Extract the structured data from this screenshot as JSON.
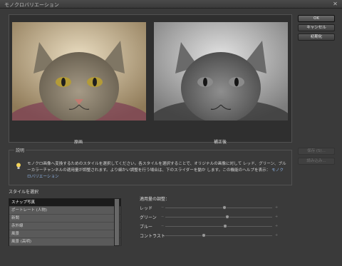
{
  "window": {
    "title": "モノクロバリエーション"
  },
  "buttons": {
    "ok": "OK",
    "cancel": "キャンセル",
    "reset": "初期化",
    "save": "保存 (S)...",
    "load": "読み込み..."
  },
  "preview": {
    "before_label": "原画",
    "after_label": "補正後"
  },
  "description": {
    "legend": "説明",
    "text": "モノクロ画像へ変換するためのスタイルを選択してください。各スタイルを選択することで、オリジナルの画像に対して レッド、グリーン、ブルーカラーチャンネルの適用量が調整されます。より細かい調整を行う場合は、下のスライダーを動か します。この機能のヘルプを表示：",
    "link": "モノクロバリエーション"
  },
  "styles": {
    "label": "スタイルを選択",
    "items": [
      "スナップ写真",
      "ポートレート (人物)",
      "新聞",
      "赤外線",
      "風景",
      "風景 (高明)"
    ],
    "selected_index": 0
  },
  "adjust": {
    "label": "適用量の調整：",
    "sliders": [
      {
        "name": "レッド",
        "value": 0.55
      },
      {
        "name": "グリーン",
        "value": 0.58
      },
      {
        "name": "ブルー",
        "value": 0.56
      },
      {
        "name": "コントラスト",
        "value": 0.36
      }
    ]
  },
  "colors": {
    "background": "#3a3a3a",
    "panel": "#2f2f2f",
    "selected_row": "#1b1b1b",
    "link": "#8fb4e6"
  }
}
